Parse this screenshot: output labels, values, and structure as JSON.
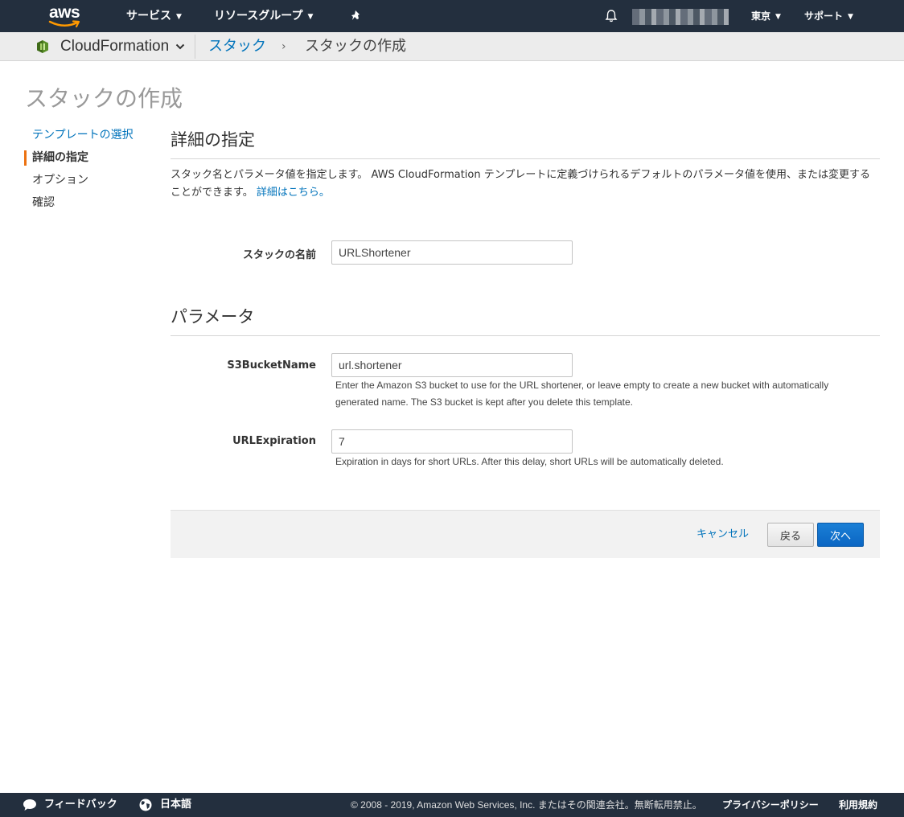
{
  "header": {
    "logo_text": "aws",
    "services_label": "サービス",
    "resource_groups_label": "リソースグループ",
    "region_label": "東京",
    "support_label": "サポート"
  },
  "breadcrumb": {
    "service_name": "CloudFormation",
    "parent_link": "スタック",
    "separator": "›",
    "current": "スタックの作成"
  },
  "page": {
    "title": "スタックの作成"
  },
  "steps": [
    {
      "label": "テンプレートの選択",
      "state": "link"
    },
    {
      "label": "詳細の指定",
      "state": "active"
    },
    {
      "label": "オプション",
      "state": "plain"
    },
    {
      "label": "確認",
      "state": "plain"
    }
  ],
  "details": {
    "heading": "詳細の指定",
    "description": "スタック名とパラメータ値を指定します。 AWS CloudFormation テンプレートに定義づけられるデフォルトのパラメータ値を使用、または変更することができます。 ",
    "learn_more_link": "詳細はこちら。",
    "stack_name_label": "スタックの名前",
    "stack_name_value": "URLShortener"
  },
  "parameters": {
    "heading": "パラメータ",
    "s3_label": "S3BucketName",
    "s3_value": "url.shortener",
    "s3_help": "Enter the Amazon S3 bucket to use for the URL shortener, or leave empty to create a new bucket with automatically generated name. The S3 bucket is kept after you delete this template.",
    "exp_label": "URLExpiration",
    "exp_value": "7",
    "exp_help": "Expiration in days for short URLs. After this delay, short URLs will be automatically deleted."
  },
  "actions": {
    "cancel_label": "キャンセル",
    "back_label": "戻る",
    "next_label": "次へ"
  },
  "footer": {
    "feedback_label": "フィードバック",
    "language_label": "日本語",
    "copyright": "© 2008 - 2019, Amazon Web Services, Inc. またはその関連会社。無断転用禁止。",
    "privacy_label": "プライバシーポリシー",
    "terms_label": "利用規約"
  },
  "colors": {
    "nav_bg": "#232f3e",
    "link": "#0073bb",
    "accent_orange": "#ec7211",
    "primary_button": "#0b66c3"
  }
}
